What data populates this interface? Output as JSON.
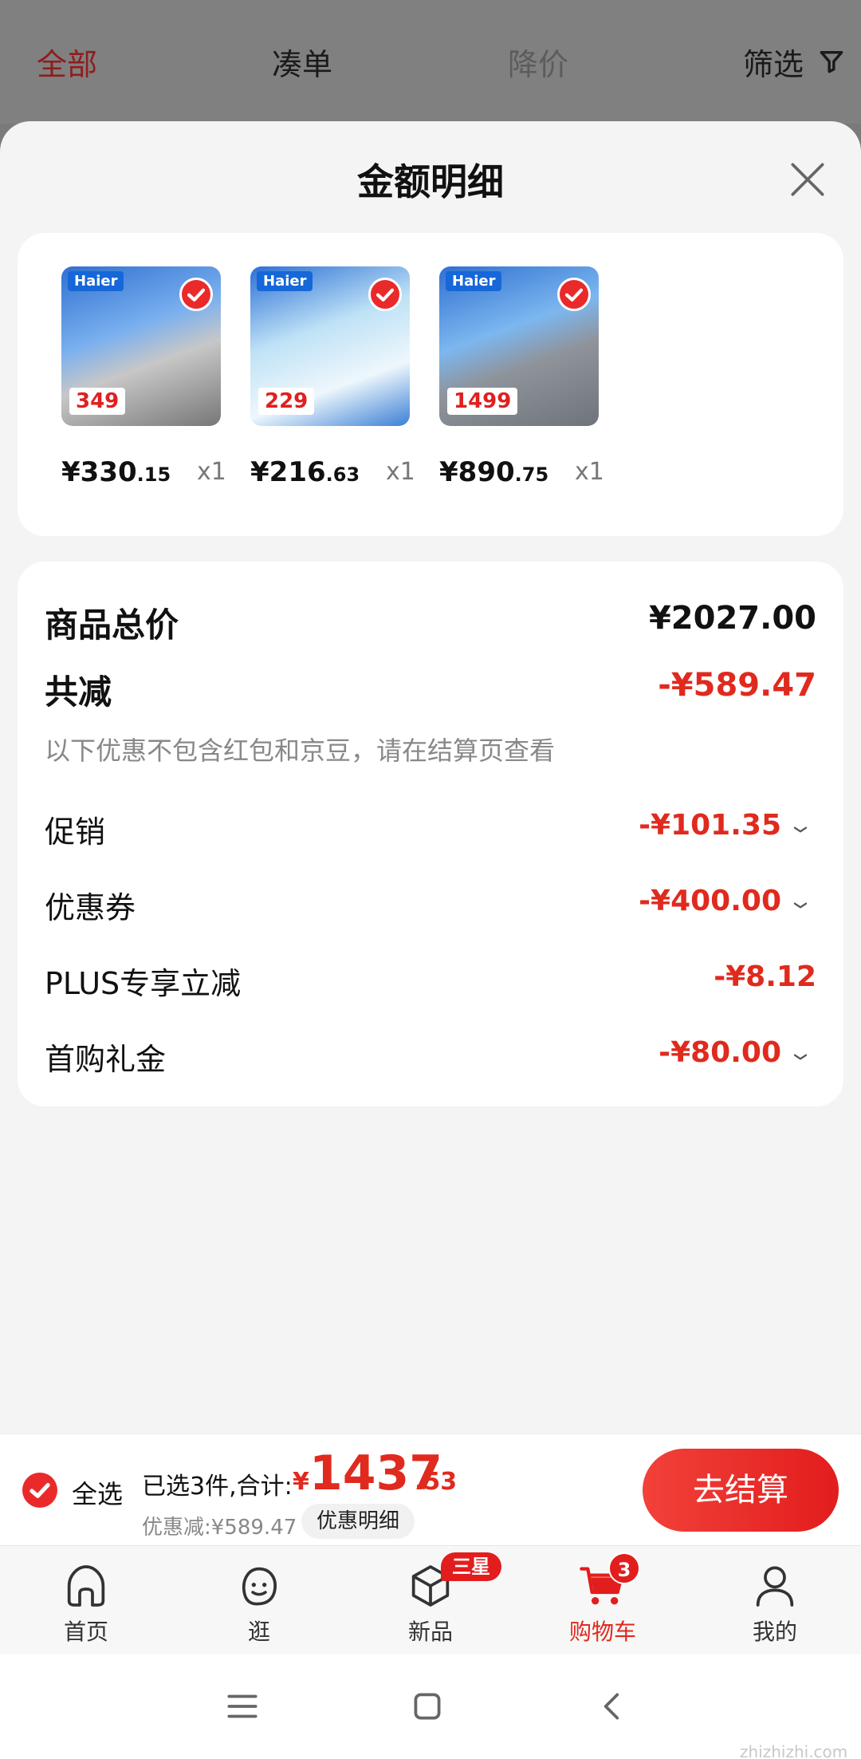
{
  "top_tabs": {
    "all": "全部",
    "bundle": "凑单",
    "price_drop": "降价",
    "filter": "筛选"
  },
  "sheet": {
    "title": "金额明细",
    "products": [
      {
        "brand": "Haier",
        "promo_price": "349",
        "price_main": "¥330",
        "price_cents": ".15",
        "qty": "x1"
      },
      {
        "brand": "Haier",
        "promo_price": "229",
        "price_main": "¥216",
        "price_cents": ".63",
        "qty": "x1"
      },
      {
        "brand": "Haier",
        "promo_price": "1499",
        "price_main": "¥890",
        "price_cents": ".75",
        "qty": "x1"
      }
    ],
    "summary": {
      "total_label": "商品总价",
      "total_value": "¥2027.00",
      "discount_label": "共减",
      "discount_value": "-¥589.47",
      "note": "以下优惠不包含红包和京豆，请在结算页查看",
      "items": [
        {
          "label": "促销",
          "value": "-¥101.35"
        },
        {
          "label": "优惠券",
          "value": "-¥400.00"
        },
        {
          "label": "PLUS专享立减",
          "value": "-¥8.12"
        },
        {
          "label": "首购礼金",
          "value": "-¥80.00"
        }
      ]
    }
  },
  "checkout": {
    "select_all": "全选",
    "selected_text": "已选3件,合计:",
    "yen": "¥",
    "total_main": "1437",
    "total_cents": ".53",
    "discount_text": "优惠减:¥589.47",
    "detail_button": "优惠明细",
    "checkout_button": "去结算"
  },
  "tabbar": {
    "items": [
      {
        "label": "首页"
      },
      {
        "label": "逛"
      },
      {
        "label": "新品"
      },
      {
        "label": "购物车"
      },
      {
        "label": "我的"
      }
    ],
    "new_badge": "三星",
    "cart_count": "3"
  },
  "watermark": "zhizhizhi.com",
  "colors": {
    "accent": "#e21d1d",
    "price_red": "#e02a1e",
    "sheet_bg": "#f4f4f4"
  }
}
